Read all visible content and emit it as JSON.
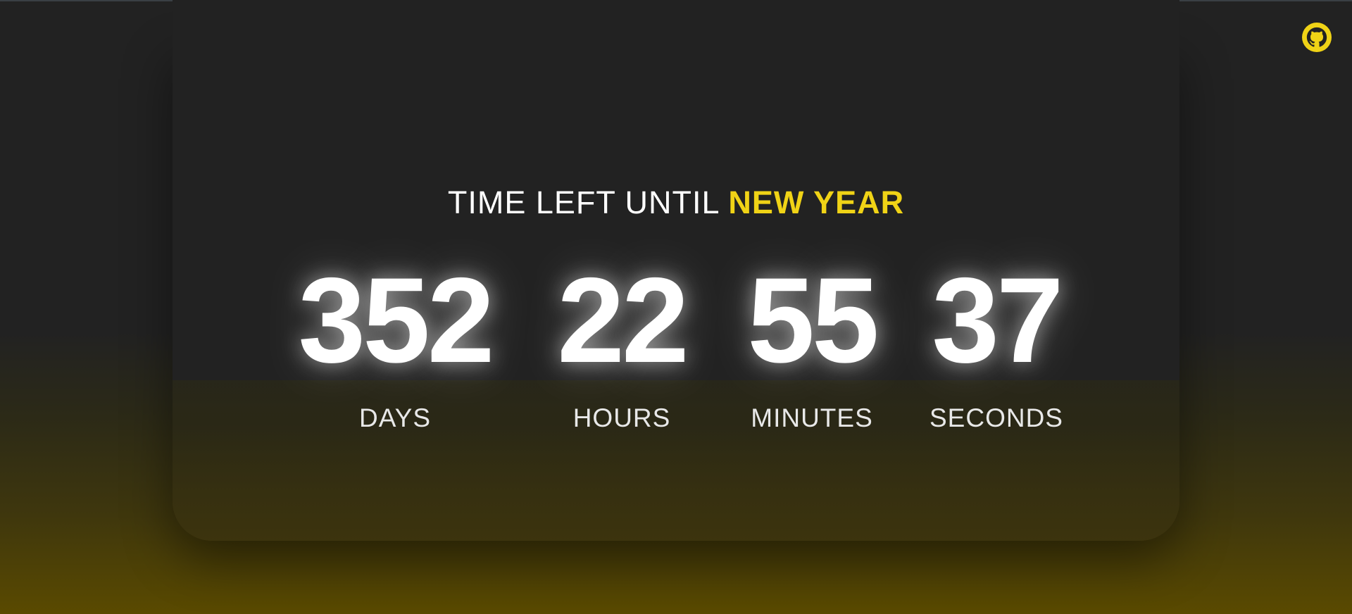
{
  "header": {
    "github_icon": "github-icon",
    "accent_color": "#f0d316"
  },
  "title": {
    "lead": "TIME LEFT UNTIL",
    "accent": "NEW YEAR"
  },
  "countdown": [
    {
      "value": "352",
      "label": "DAYS"
    },
    {
      "value": "22",
      "label": "HOURS"
    },
    {
      "value": "55",
      "label": "MINUTES"
    },
    {
      "value": "37",
      "label": "SECONDS"
    }
  ],
  "colors": {
    "background": "#222222",
    "glow_bottom": "#5a4a00",
    "text": "#ffffff"
  }
}
